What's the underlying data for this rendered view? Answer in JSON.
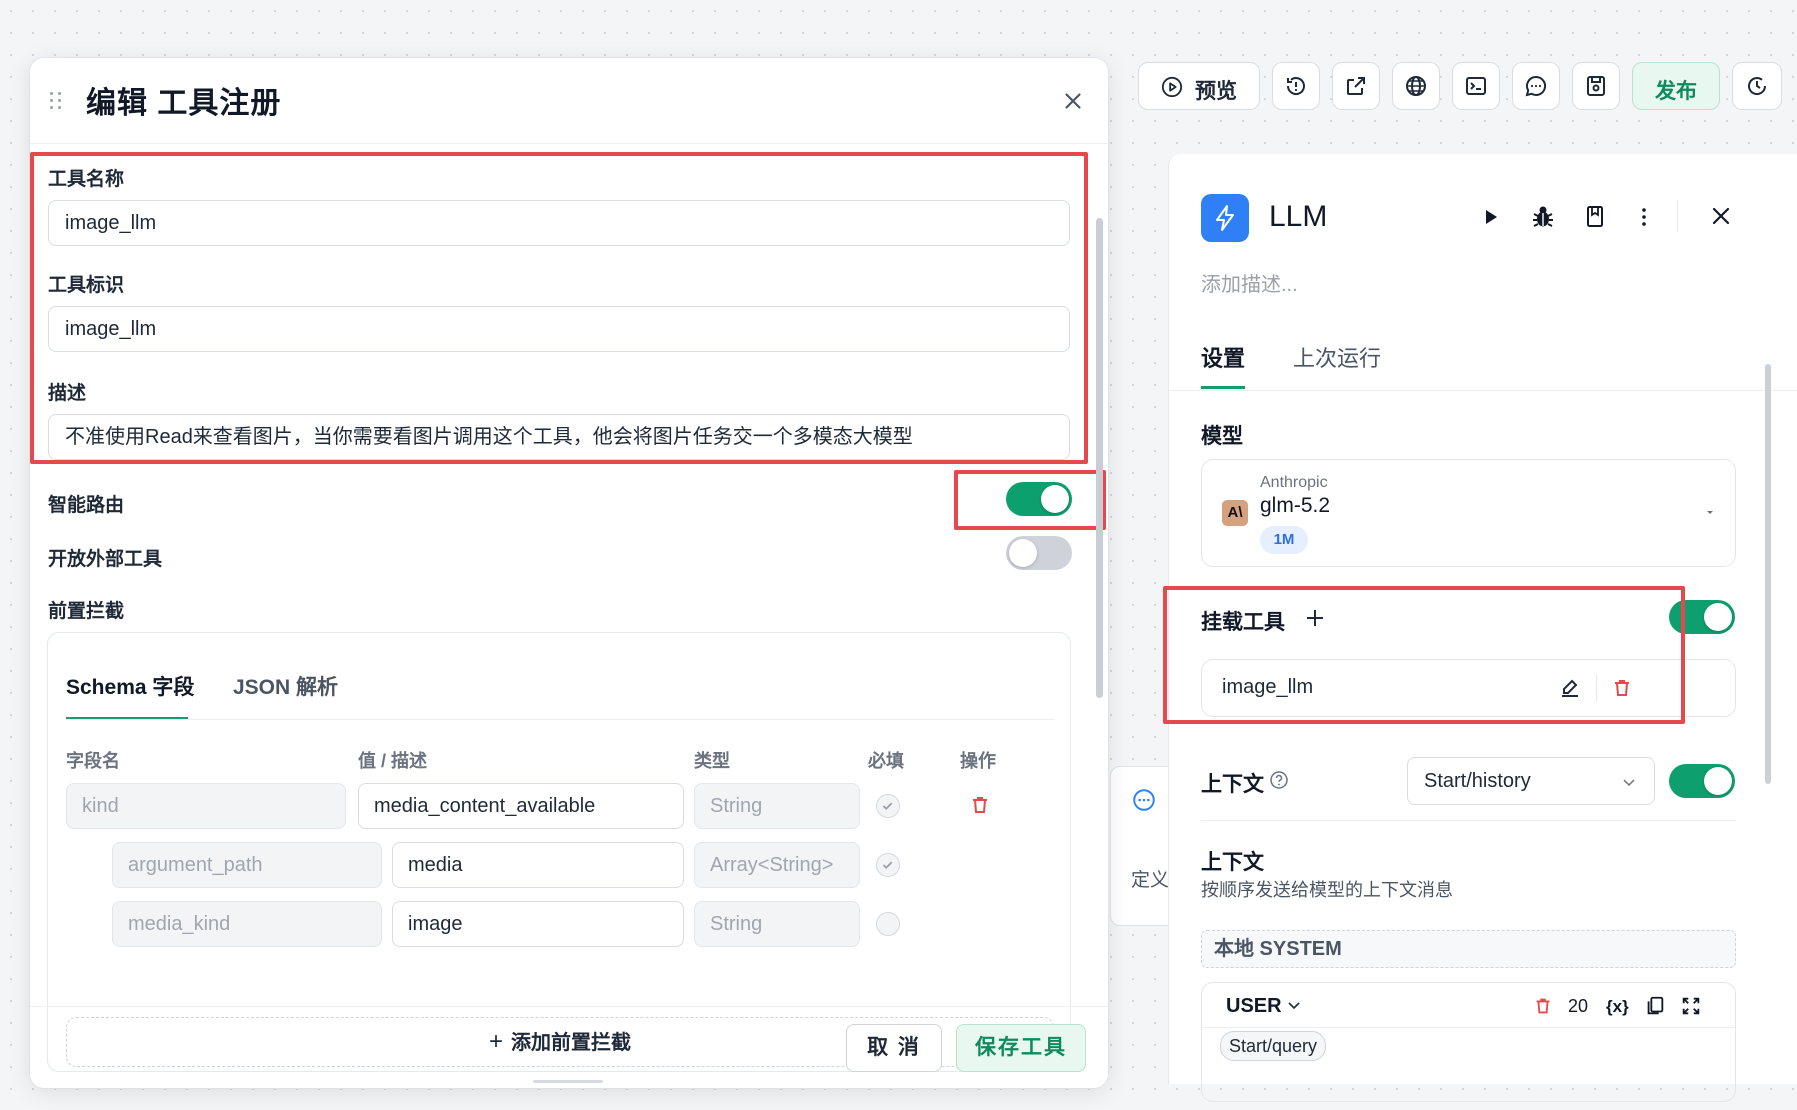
{
  "modal": {
    "title": "编辑 工具注册",
    "fields": {
      "tool_name_label": "工具名称",
      "tool_name_value": "image_llm",
      "tool_id_label": "工具标识",
      "tool_id_value": "image_llm",
      "desc_label": "描述",
      "desc_value": "不准使用Read来查看图片，当你需要看图片调用这个工具，他会将图片任务交一个多模态大模型"
    },
    "smart_routing_label": "智能路由",
    "smart_routing_on": true,
    "open_external_label": "开放外部工具",
    "open_external_on": false,
    "pre_intercept_label": "前置拦截",
    "tabs": [
      "Schema 字段",
      "JSON 解析"
    ],
    "columns": [
      "字段名",
      "值 / 描述",
      "类型",
      "必填",
      "操作"
    ],
    "rows": [
      {
        "name": "kind",
        "value": "media_content_available",
        "type": "String",
        "required": true
      },
      {
        "name": "argument_path",
        "value": "media",
        "type": "Array<String>",
        "required": true
      },
      {
        "name": "media_kind",
        "value": "image",
        "type": "String",
        "required": false
      }
    ],
    "add_intercept_label": "添加前置拦截",
    "cancel_label": "取 消",
    "save_label": "保存工具"
  },
  "toolbar": {
    "preview_label": "预览",
    "publish_label": "发布"
  },
  "panel": {
    "title": "LLM",
    "desc_placeholder": "添加描述...",
    "tabs": [
      "设置",
      "上次运行"
    ],
    "model_section": "模型",
    "model_provider": "Anthropic",
    "model_name": "glm-5.2",
    "model_badge": "1M",
    "tools_section": "挂载工具",
    "tools_enabled": true,
    "mounted_tool": "image_llm",
    "context_label": "上下文",
    "context_select": "Start/history",
    "context_enabled": true,
    "context_title": "上下文",
    "context_desc": "按顺序发送给模型的上下文消息",
    "system_label": "本地 SYSTEM",
    "user_label": "USER",
    "user_count": "20",
    "var_icon_text": "{x}",
    "user_chip": "Start/query"
  },
  "background": {
    "side_text": "定义"
  },
  "colors": {
    "accent_green": "#0e9f6e",
    "annotation_red": "#e5484d",
    "brand_blue": "#2f80f7",
    "danger": "#e5484d"
  }
}
